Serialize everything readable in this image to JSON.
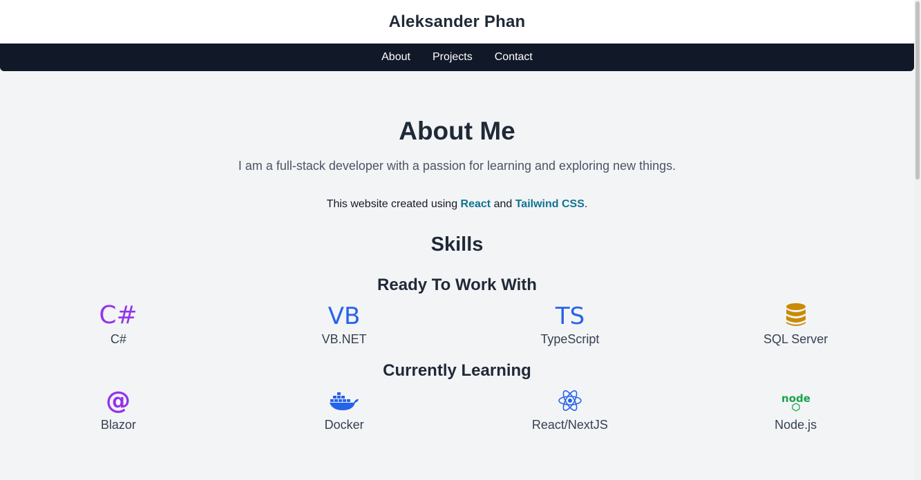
{
  "header": {
    "site_title": "Aleksander Phan"
  },
  "nav": {
    "items": [
      "About",
      "Projects",
      "Contact"
    ]
  },
  "about": {
    "title": "About Me",
    "description": "I am a full-stack developer with a passion for learning and exploring new things.",
    "built_prefix": "This website created using ",
    "built_link1": "React",
    "built_and": " and ",
    "built_link2": "Tailwind CSS",
    "built_suffix": "."
  },
  "skills": {
    "title": "Skills",
    "groups": [
      {
        "title": "Ready To Work With",
        "items": [
          {
            "label": "C#",
            "icon": "csharp-icon",
            "color": "#9333ea"
          },
          {
            "label": "VB.NET",
            "icon": "vbnet-icon",
            "color": "#2563eb"
          },
          {
            "label": "TypeScript",
            "icon": "typescript-icon",
            "color": "#2563eb"
          },
          {
            "label": "SQL Server",
            "icon": "database-icon",
            "color": "#ca8a04"
          }
        ]
      },
      {
        "title": "Currently Learning",
        "items": [
          {
            "label": "Blazor",
            "icon": "blazor-icon",
            "color": "#9333ea"
          },
          {
            "label": "Docker",
            "icon": "docker-icon",
            "color": "#2563eb"
          },
          {
            "label": "React/NextJS",
            "icon": "react-icon",
            "color": "#2563eb"
          },
          {
            "label": "Node.js",
            "icon": "nodejs-icon",
            "color": "#16a34a"
          }
        ]
      }
    ]
  },
  "colors": {
    "accent_link": "#0e7490",
    "nav_bg": "#111827",
    "page_bg": "#f3f4f6"
  }
}
